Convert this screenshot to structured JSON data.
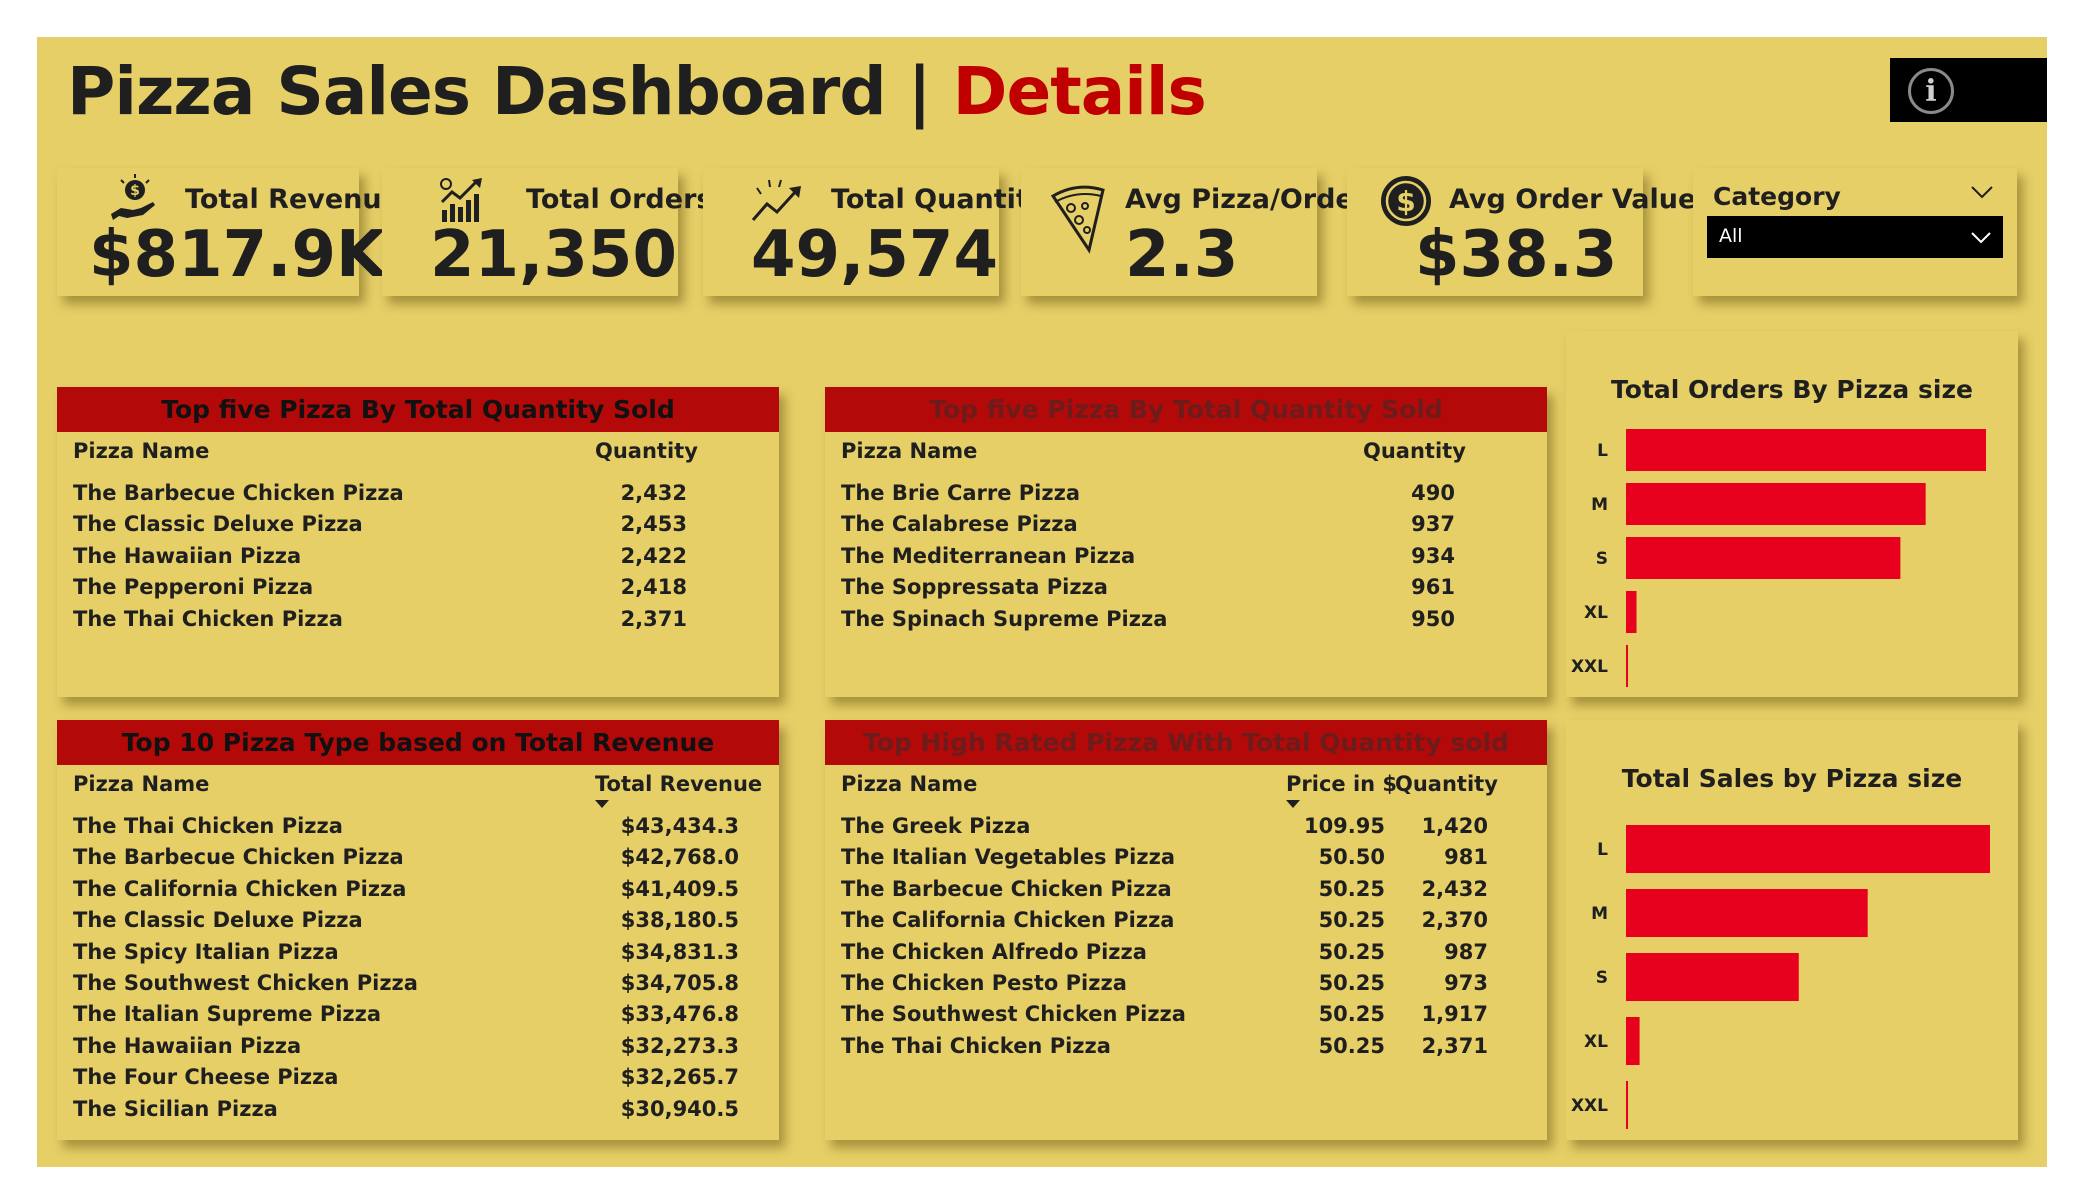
{
  "header": {
    "title": "Pizza Sales Dashboard",
    "separator": "|",
    "accent": "Details"
  },
  "colors": {
    "background": "#E6CF66",
    "accent": "#C00000",
    "table_header": "#B30909",
    "bar": "#E8001F"
  },
  "kpis": [
    {
      "label": "Total Revenue",
      "value": "$817.9K",
      "icon": "hand-money-icon"
    },
    {
      "label": "Total Orders",
      "value": "21,350",
      "icon": "growth-chart-icon"
    },
    {
      "label": "Total Quantity",
      "value": "49,574",
      "icon": "trend-arrow-icon"
    },
    {
      "label": "Avg Pizza/Order",
      "value": "2.3",
      "icon": "pizza-slice-icon"
    },
    {
      "label": "Avg Order Value",
      "value": "$38.3",
      "icon": "dollar-coin-icon"
    }
  ],
  "slicer": {
    "label": "Category",
    "value": "All"
  },
  "tables": [
    {
      "title": "Top five Pizza By Total Quantity Sold",
      "col1": "Pizza Name",
      "col2": "Quantity",
      "rows": [
        [
          "The Barbecue Chicken Pizza",
          "2,432"
        ],
        [
          "The Classic Deluxe Pizza",
          "2,453"
        ],
        [
          "The Hawaiian Pizza",
          "2,422"
        ],
        [
          "The Pepperoni Pizza",
          "2,418"
        ],
        [
          "The Thai Chicken Pizza",
          "2,371"
        ]
      ]
    },
    {
      "title": "Top five Pizza By Total Quantity Sold",
      "col1": "Pizza Name",
      "col2": "Quantity",
      "rows": [
        [
          "The Brie Carre Pizza",
          "490"
        ],
        [
          "The Calabrese Pizza",
          "937"
        ],
        [
          "The Mediterranean Pizza",
          "934"
        ],
        [
          "The Soppressata Pizza",
          "961"
        ],
        [
          "The Spinach Supreme Pizza",
          "950"
        ]
      ]
    },
    {
      "title": "Top 10 Pizza Type based on Total Revenue",
      "col1": "Pizza Name",
      "col2": "Total Revenue",
      "rows": [
        [
          "The Thai Chicken Pizza",
          "$43,434.3"
        ],
        [
          "The Barbecue Chicken Pizza",
          "$42,768.0"
        ],
        [
          "The California Chicken Pizza",
          "$41,409.5"
        ],
        [
          "The Classic Deluxe Pizza",
          "$38,180.5"
        ],
        [
          "The Spicy Italian Pizza",
          "$34,831.3"
        ],
        [
          "The Southwest Chicken Pizza",
          "$34,705.8"
        ],
        [
          "The Italian Supreme Pizza",
          "$33,476.8"
        ],
        [
          "The Hawaiian Pizza",
          "$32,273.3"
        ],
        [
          "The Four Cheese Pizza",
          "$32,265.7"
        ],
        [
          "The Sicilian Pizza",
          "$30,940.5"
        ]
      ]
    },
    {
      "title": "Top High Rated Pizza With Total Quantity sold",
      "col1": "Pizza Name",
      "col2": "Price in $",
      "col3": "Quantity",
      "rows": [
        [
          "The Greek Pizza",
          "109.95",
          "1,420"
        ],
        [
          "The Italian Vegetables Pizza",
          "50.50",
          "981"
        ],
        [
          "The Barbecue Chicken Pizza",
          "50.25",
          "2,432"
        ],
        [
          "The California Chicken Pizza",
          "50.25",
          "2,370"
        ],
        [
          "The Chicken Alfredo Pizza",
          "50.25",
          "987"
        ],
        [
          "The Chicken Pesto Pizza",
          "50.25",
          "973"
        ],
        [
          "The Southwest Chicken Pizza",
          "50.25",
          "1,917"
        ],
        [
          "The Thai Chicken Pizza",
          "50.25",
          "2,371"
        ]
      ]
    }
  ],
  "chart_data": [
    {
      "type": "bar",
      "orientation": "horizontal",
      "title": "Total Orders By Pizza size",
      "categories": [
        "L",
        "M",
        "S",
        "XL",
        "XXL"
      ],
      "values": [
        18500,
        15400,
        14100,
        540,
        28
      ],
      "xlim": [
        0,
        18500
      ]
    },
    {
      "type": "bar",
      "orientation": "horizontal",
      "title": "Total Sales by Pizza size",
      "categories": [
        "L",
        "M",
        "S",
        "XL",
        "XXL"
      ],
      "values": [
        375000,
        249000,
        178000,
        14000,
        1000
      ],
      "xlim": [
        0,
        375000
      ]
    }
  ]
}
